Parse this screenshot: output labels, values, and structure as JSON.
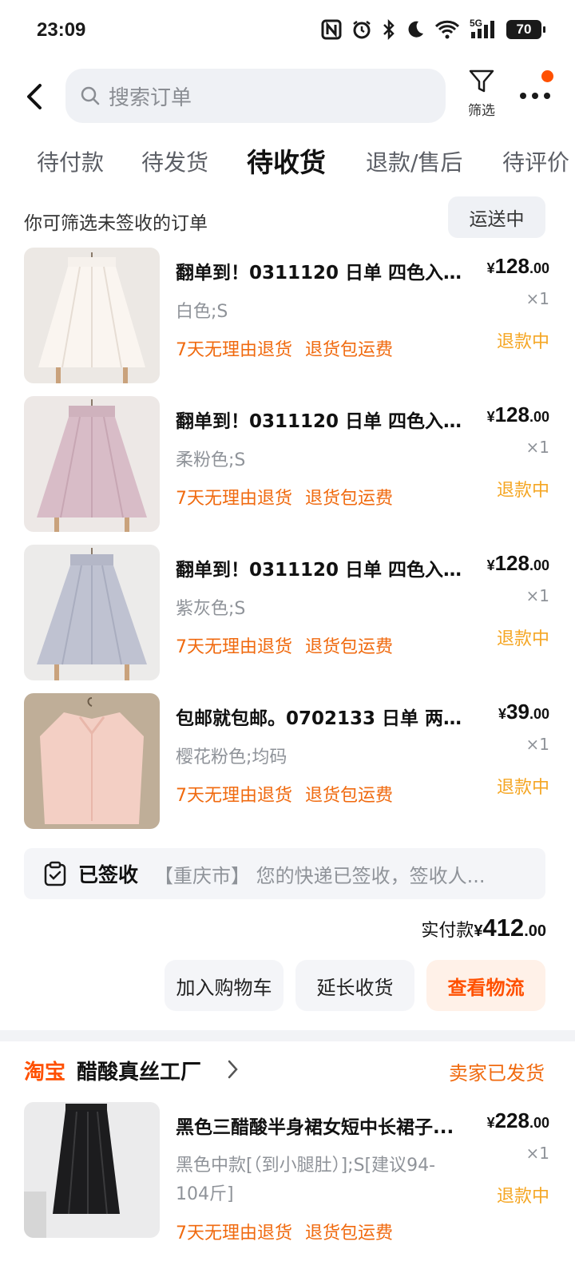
{
  "status_bar": {
    "time": "23:09",
    "icons": [
      "nfc-icon",
      "alarm-icon",
      "bluetooth-icon",
      "moon-icon",
      "wifi-icon",
      "signal-5g-icon"
    ],
    "network_label": "5G",
    "battery": "70"
  },
  "header": {
    "search_placeholder": "搜索订单",
    "filter_label": "筛选",
    "notification_dot_color": "#ff5000"
  },
  "tabs": [
    {
      "label": "待付款",
      "active": false
    },
    {
      "label": "待发货",
      "active": false
    },
    {
      "label": "待收货",
      "active": true
    },
    {
      "label": "退款/售后",
      "active": false
    },
    {
      "label": "待评价",
      "active": false
    }
  ],
  "hint": {
    "text": "你可筛选未签收的订单",
    "chip_label": "运送中"
  },
  "order1": {
    "items": [
      {
        "title": "翻单到！0311120 日单 四色入 ...",
        "price_currency": "¥",
        "price_int": "128",
        "price_dec": ".00",
        "quantity": "×1",
        "spec": "白色;S",
        "status": "退款中",
        "tags": [
          "7天无理由退货",
          "退货包运费"
        ],
        "thumb_color": "#f4ece6"
      },
      {
        "title": "翻单到！0311120 日单 四色入 ...",
        "price_currency": "¥",
        "price_int": "128",
        "price_dec": ".00",
        "quantity": "×1",
        "spec": "柔粉色;S",
        "status": "退款中",
        "tags": [
          "7天无理由退货",
          "退货包运费"
        ],
        "thumb_color": "#d9bcc6"
      },
      {
        "title": "翻单到！0311120 日单 四色入 ...",
        "price_currency": "¥",
        "price_int": "128",
        "price_dec": ".00",
        "quantity": "×1",
        "spec": "紫灰色;S",
        "status": "退款中",
        "tags": [
          "7天无理由退货",
          "退货包运费"
        ],
        "thumb_color": "#b9bccc"
      },
      {
        "title": "包邮就包邮。0702133 日单 两色...",
        "price_currency": "¥",
        "price_int": "39",
        "price_dec": ".00",
        "quantity": "×1",
        "spec": "樱花粉色;均码",
        "status": "退款中",
        "tags": [
          "7天无理由退货",
          "退货包运费"
        ],
        "thumb_color": "#f1cbc0"
      }
    ],
    "logistics": {
      "label": "已签收",
      "message": "【重庆市】 您的快递已签收，签收人..."
    },
    "total": {
      "label": "实付款",
      "currency": "¥",
      "int": "412",
      "dec": ".00"
    },
    "actions": {
      "add_cart": "加入购物车",
      "extend": "延长收货",
      "logistics": "查看物流"
    }
  },
  "order2": {
    "brand": "淘宝",
    "shop_name": "醋酸真丝工厂",
    "status": "卖家已发货",
    "item": {
      "title": "黑色三醋酸半身裙女短中长裙子...",
      "price_currency": "¥",
      "price_int": "228",
      "price_dec": ".00",
      "quantity": "×1",
      "spec": "黑色中款[（到小腿肚）];S[建议94-104斤]",
      "status": "退款中",
      "tags": [
        "7天无理由退货",
        "退货包运费"
      ],
      "thumb_color": "#e9e9ea"
    }
  },
  "colors": {
    "accent_orange": "#ff5000",
    "tag_orange": "#f06a0f",
    "refund_yellow": "#f5a623"
  }
}
